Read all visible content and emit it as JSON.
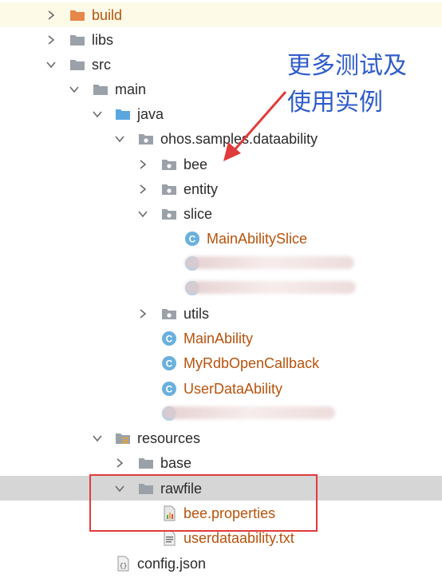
{
  "tree": {
    "build": "build",
    "libs": "libs",
    "src": "src",
    "main": "main",
    "java": "java",
    "package": "ohos.samples.dataability",
    "bee": "bee",
    "entity": "entity",
    "slice": "slice",
    "main_ability_slice": "MainAbilitySlice",
    "utils": "utils",
    "main_ability": "MainAbility",
    "my_rdb_open_callback": "MyRdbOpenCallback",
    "user_data_ability": "UserDataAbility",
    "resources": "resources",
    "base": "base",
    "rawfile": "rawfile",
    "bee_properties": "bee.properties",
    "userdataability_txt": "userdataability.txt",
    "config_json": "config.json"
  },
  "annotation": {
    "line1": "更多测试及",
    "line2": "使用实例"
  },
  "colors": {
    "class_icon": "#6ab0de",
    "folder_gray": "#9aa1a8",
    "folder_blue": "#5aa7e0",
    "folder_orange": "#e8874a",
    "annotation_blue": "#2f5ccc",
    "highlight_red": "#e13b3b",
    "file_orange": "#b8520c"
  }
}
